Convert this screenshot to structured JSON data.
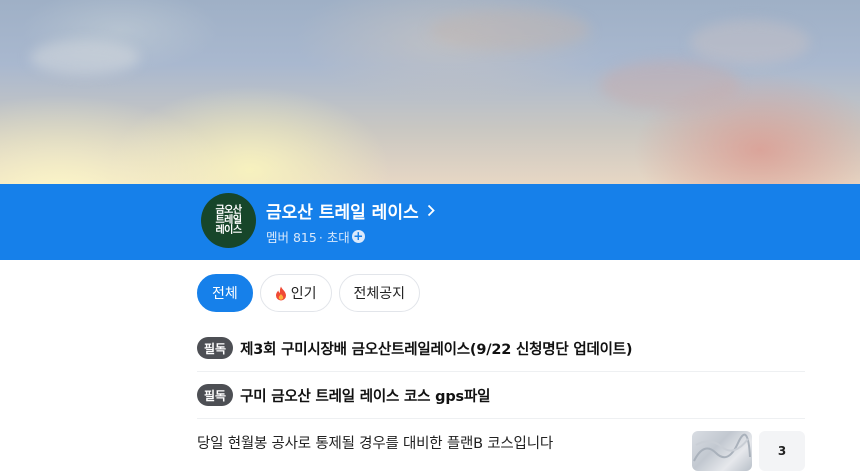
{
  "cafe": {
    "logo_lines": [
      "금오산",
      "트레일",
      "레이스"
    ],
    "name": "금오산 트레일 레이스",
    "members_label": "멤버 815",
    "invite_label": "· 초대"
  },
  "tabs": [
    {
      "label": "전체",
      "active": true
    },
    {
      "label": "인기",
      "icon": "fire-icon"
    },
    {
      "label": "전체공지"
    }
  ],
  "posts": [
    {
      "badge": "필독",
      "title": "제3회 구미시장배 금오산트레일레이스(9/22 신청명단 업데이트)"
    },
    {
      "badge": "필독",
      "title": "구미 금오산 트레일 레이스 코스 gps파일"
    },
    {
      "title": "당일 현월봉 공사로 통제될 경우를 대비한 플랜B 코스입니다",
      "comment_count": "3"
    }
  ],
  "colors": {
    "brand_blue": "#1680ea",
    "logo_green": "#17462a",
    "badge_gray": "#4d4f54"
  }
}
